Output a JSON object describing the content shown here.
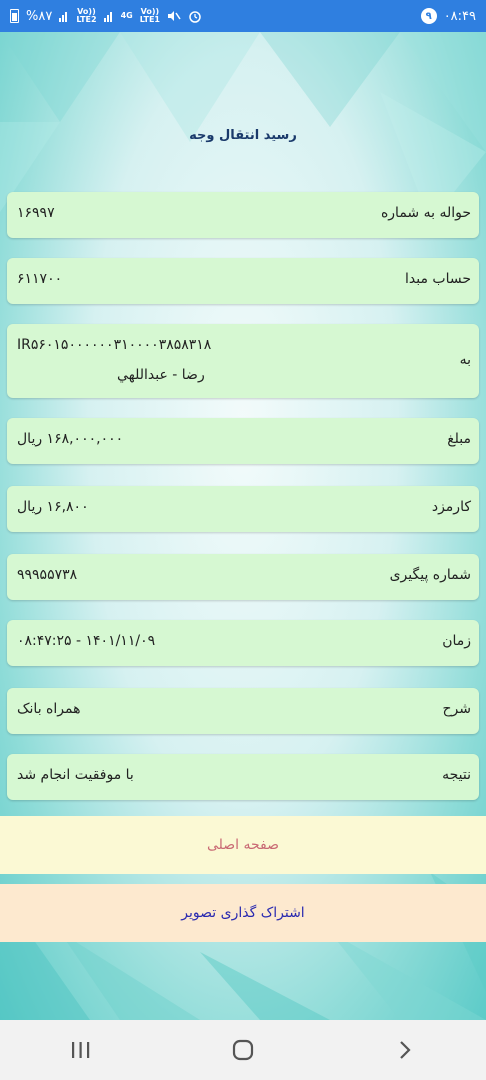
{
  "status_bar": {
    "battery": "%۸۷",
    "net1": "Vo))\nLTE2",
    "net2": "4G",
    "net3": "Vo))\nLTE1",
    "notif_count": "۹",
    "time": "۰۸:۴۹"
  },
  "page": {
    "title": "رسید انتقال وجه"
  },
  "receipt": {
    "transfer_label": "حواله به شماره",
    "transfer_value": "۱۶۹۹۷",
    "source_label": "حساب مبدا",
    "source_value": "۶۱۱۷۰۰",
    "to_label": "به",
    "to_iban": "IR۵۶۰۱۵۰۰۰۰۰۰۳۱۰۰۰۰۳۸۵۸۳۱۸",
    "to_name": "رضا    - عبداللهي",
    "amount_label": "مبلغ",
    "amount_value": "۱۶۸,۰۰۰,۰۰۰ ریال",
    "fee_label": "کارمزد",
    "fee_value": "۱۶,۸۰۰ ریال",
    "tracking_label": "شماره پیگیری",
    "tracking_value": "۹۹۹۵۵۷۳۸",
    "time_label": "زمان",
    "time_value": "۱۴۰۱/۱۱/۰۹ - ۰۸:۴۷:۲۵",
    "desc_label": "شرح",
    "desc_value": "همراه بانک",
    "result_label": "نتیجه",
    "result_value": "با موفقیت انجام شد"
  },
  "buttons": {
    "home": "صفحه اصلی",
    "share": "اشتراک گذاری تصویر"
  },
  "colors": {
    "status_bar": "#2f7fe0",
    "row_bg": "#d6f8d2",
    "home_bg": "#fbf9d4",
    "share_bg": "#fde9cf"
  }
}
